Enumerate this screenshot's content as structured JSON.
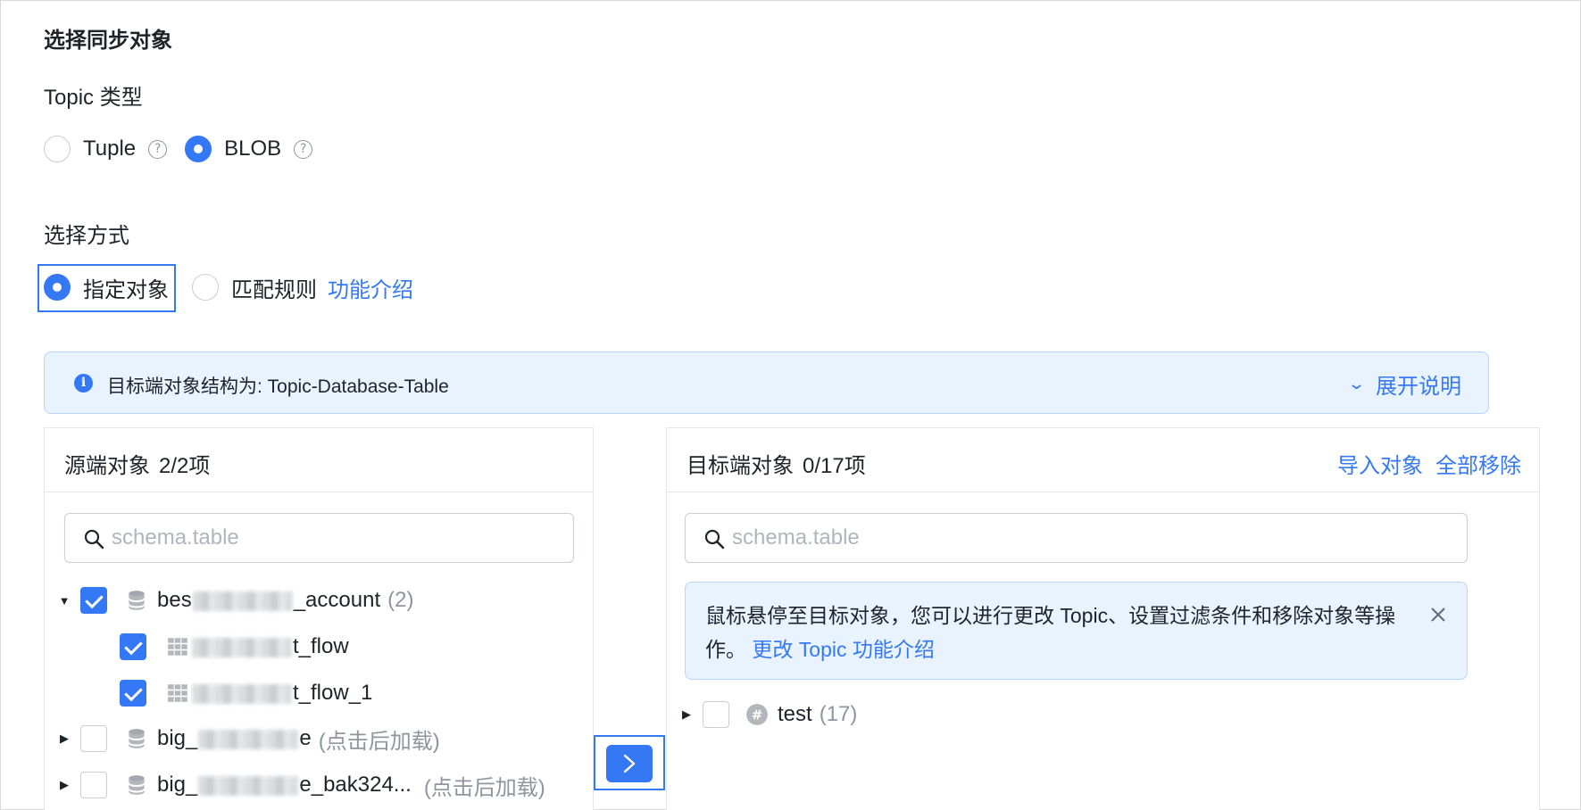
{
  "section_title": "选择同步对象",
  "topic_type": {
    "label": "Topic 类型",
    "options": [
      {
        "label": "Tuple",
        "checked": false
      },
      {
        "label": "BLOB",
        "checked": true
      }
    ]
  },
  "selection_mode": {
    "label": "选择方式",
    "options": [
      {
        "label": "指定对象",
        "checked": true
      },
      {
        "label": "匹配规则",
        "checked": false
      }
    ],
    "intro_link": "功能介绍"
  },
  "info_bar": {
    "text": "目标端对象结构为: Topic-Database-Table",
    "expand_label": "展开说明"
  },
  "source_panel": {
    "title": "源端对象",
    "count": "2/2项",
    "search_placeholder": "schema.table",
    "tree": [
      {
        "prefix": "bes",
        "suffix": "_account",
        "count": "(2)",
        "checked": true,
        "expanded": true,
        "type": "database"
      },
      {
        "prefix": "",
        "suffix": "t_flow",
        "checked": true,
        "type": "table"
      },
      {
        "prefix": "",
        "suffix": "t_flow_1",
        "checked": true,
        "type": "table"
      },
      {
        "prefix": "big_",
        "suffix": "e",
        "count": "(点击后加载)",
        "checked": false,
        "expanded": false,
        "type": "database"
      },
      {
        "prefix": "big_",
        "suffix": "e_bak324...",
        "count": "(点击后加载)",
        "checked": false,
        "expanded": false,
        "type": "database"
      }
    ]
  },
  "target_panel": {
    "title": "目标端对象",
    "count": "0/17项",
    "actions": {
      "import": "导入对象",
      "remove_all": "全部移除"
    },
    "search_placeholder": "schema.table",
    "tip": {
      "text": "鼠标悬停至目标对象，您可以进行更改 Topic、设置过滤条件和移除对象等操作。",
      "link": "更改 Topic 功能介绍"
    },
    "tree": [
      {
        "label": "test",
        "count": "(17)",
        "checked": false,
        "expanded": false,
        "type": "topic"
      }
    ]
  },
  "colors": {
    "accent": "#3478f6",
    "info_bg": "#e8f3ff",
    "muted": "#8f959e"
  }
}
